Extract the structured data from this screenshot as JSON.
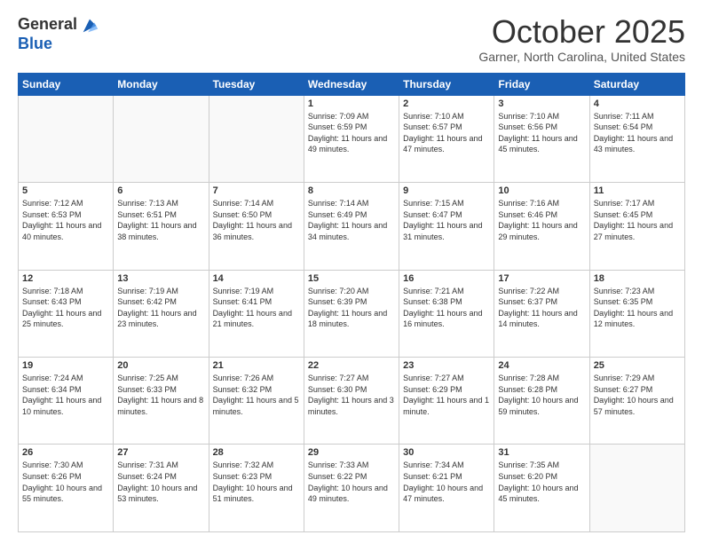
{
  "header": {
    "logo_general": "General",
    "logo_blue": "Blue",
    "month": "October 2025",
    "location": "Garner, North Carolina, United States"
  },
  "days_of_week": [
    "Sunday",
    "Monday",
    "Tuesday",
    "Wednesday",
    "Thursday",
    "Friday",
    "Saturday"
  ],
  "weeks": [
    [
      {
        "day": "",
        "info": ""
      },
      {
        "day": "",
        "info": ""
      },
      {
        "day": "",
        "info": ""
      },
      {
        "day": "1",
        "info": "Sunrise: 7:09 AM\nSunset: 6:59 PM\nDaylight: 11 hours and 49 minutes."
      },
      {
        "day": "2",
        "info": "Sunrise: 7:10 AM\nSunset: 6:57 PM\nDaylight: 11 hours and 47 minutes."
      },
      {
        "day": "3",
        "info": "Sunrise: 7:10 AM\nSunset: 6:56 PM\nDaylight: 11 hours and 45 minutes."
      },
      {
        "day": "4",
        "info": "Sunrise: 7:11 AM\nSunset: 6:54 PM\nDaylight: 11 hours and 43 minutes."
      }
    ],
    [
      {
        "day": "5",
        "info": "Sunrise: 7:12 AM\nSunset: 6:53 PM\nDaylight: 11 hours and 40 minutes."
      },
      {
        "day": "6",
        "info": "Sunrise: 7:13 AM\nSunset: 6:51 PM\nDaylight: 11 hours and 38 minutes."
      },
      {
        "day": "7",
        "info": "Sunrise: 7:14 AM\nSunset: 6:50 PM\nDaylight: 11 hours and 36 minutes."
      },
      {
        "day": "8",
        "info": "Sunrise: 7:14 AM\nSunset: 6:49 PM\nDaylight: 11 hours and 34 minutes."
      },
      {
        "day": "9",
        "info": "Sunrise: 7:15 AM\nSunset: 6:47 PM\nDaylight: 11 hours and 31 minutes."
      },
      {
        "day": "10",
        "info": "Sunrise: 7:16 AM\nSunset: 6:46 PM\nDaylight: 11 hours and 29 minutes."
      },
      {
        "day": "11",
        "info": "Sunrise: 7:17 AM\nSunset: 6:45 PM\nDaylight: 11 hours and 27 minutes."
      }
    ],
    [
      {
        "day": "12",
        "info": "Sunrise: 7:18 AM\nSunset: 6:43 PM\nDaylight: 11 hours and 25 minutes."
      },
      {
        "day": "13",
        "info": "Sunrise: 7:19 AM\nSunset: 6:42 PM\nDaylight: 11 hours and 23 minutes."
      },
      {
        "day": "14",
        "info": "Sunrise: 7:19 AM\nSunset: 6:41 PM\nDaylight: 11 hours and 21 minutes."
      },
      {
        "day": "15",
        "info": "Sunrise: 7:20 AM\nSunset: 6:39 PM\nDaylight: 11 hours and 18 minutes."
      },
      {
        "day": "16",
        "info": "Sunrise: 7:21 AM\nSunset: 6:38 PM\nDaylight: 11 hours and 16 minutes."
      },
      {
        "day": "17",
        "info": "Sunrise: 7:22 AM\nSunset: 6:37 PM\nDaylight: 11 hours and 14 minutes."
      },
      {
        "day": "18",
        "info": "Sunrise: 7:23 AM\nSunset: 6:35 PM\nDaylight: 11 hours and 12 minutes."
      }
    ],
    [
      {
        "day": "19",
        "info": "Sunrise: 7:24 AM\nSunset: 6:34 PM\nDaylight: 11 hours and 10 minutes."
      },
      {
        "day": "20",
        "info": "Sunrise: 7:25 AM\nSunset: 6:33 PM\nDaylight: 11 hours and 8 minutes."
      },
      {
        "day": "21",
        "info": "Sunrise: 7:26 AM\nSunset: 6:32 PM\nDaylight: 11 hours and 5 minutes."
      },
      {
        "day": "22",
        "info": "Sunrise: 7:27 AM\nSunset: 6:30 PM\nDaylight: 11 hours and 3 minutes."
      },
      {
        "day": "23",
        "info": "Sunrise: 7:27 AM\nSunset: 6:29 PM\nDaylight: 11 hours and 1 minute."
      },
      {
        "day": "24",
        "info": "Sunrise: 7:28 AM\nSunset: 6:28 PM\nDaylight: 10 hours and 59 minutes."
      },
      {
        "day": "25",
        "info": "Sunrise: 7:29 AM\nSunset: 6:27 PM\nDaylight: 10 hours and 57 minutes."
      }
    ],
    [
      {
        "day": "26",
        "info": "Sunrise: 7:30 AM\nSunset: 6:26 PM\nDaylight: 10 hours and 55 minutes."
      },
      {
        "day": "27",
        "info": "Sunrise: 7:31 AM\nSunset: 6:24 PM\nDaylight: 10 hours and 53 minutes."
      },
      {
        "day": "28",
        "info": "Sunrise: 7:32 AM\nSunset: 6:23 PM\nDaylight: 10 hours and 51 minutes."
      },
      {
        "day": "29",
        "info": "Sunrise: 7:33 AM\nSunset: 6:22 PM\nDaylight: 10 hours and 49 minutes."
      },
      {
        "day": "30",
        "info": "Sunrise: 7:34 AM\nSunset: 6:21 PM\nDaylight: 10 hours and 47 minutes."
      },
      {
        "day": "31",
        "info": "Sunrise: 7:35 AM\nSunset: 6:20 PM\nDaylight: 10 hours and 45 minutes."
      },
      {
        "day": "",
        "info": ""
      }
    ]
  ]
}
